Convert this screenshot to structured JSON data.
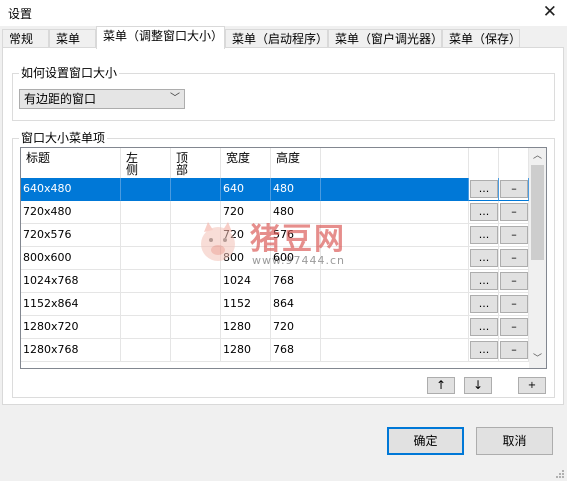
{
  "window": {
    "title": "设置",
    "close_glyph": "✕"
  },
  "tabs": [
    {
      "label": "常规",
      "active": false
    },
    {
      "label": "菜单",
      "active": false
    },
    {
      "label": "菜单（调整窗口大小）",
      "active": true
    },
    {
      "label": "菜单（启动程序）",
      "active": false
    },
    {
      "label": "菜单（窗户调光器）",
      "active": false
    },
    {
      "label": "菜单（保存）",
      "active": false
    }
  ],
  "sizing_group": {
    "label": "如何设置窗口大小",
    "combo_value": "有边距的窗口"
  },
  "items_group": {
    "label": "窗口大小菜单项"
  },
  "table": {
    "columns": [
      "标题",
      "左\n侧",
      "顶\n部",
      "宽度",
      "高度"
    ],
    "rows": [
      {
        "title": "640x480",
        "left": "",
        "top": "",
        "width": "640",
        "height": "480",
        "selected": true
      },
      {
        "title": "720x480",
        "left": "",
        "top": "",
        "width": "720",
        "height": "480",
        "selected": false
      },
      {
        "title": "720x576",
        "left": "",
        "top": "",
        "width": "720",
        "height": "576",
        "selected": false
      },
      {
        "title": "800x600",
        "left": "",
        "top": "",
        "width": "800",
        "height": "600",
        "selected": false
      },
      {
        "title": "1024x768",
        "left": "",
        "top": "",
        "width": "1024",
        "height": "768",
        "selected": false
      },
      {
        "title": "1152x864",
        "left": "",
        "top": "",
        "width": "1152",
        "height": "864",
        "selected": false
      },
      {
        "title": "1280x720",
        "left": "",
        "top": "",
        "width": "1280",
        "height": "720",
        "selected": false
      },
      {
        "title": "1280x768",
        "left": "",
        "top": "",
        "width": "1280",
        "height": "768",
        "selected": false
      }
    ],
    "edit_label": "...",
    "remove_label": "–"
  },
  "list_buttons": {
    "up": "↑",
    "down": "↓",
    "add": "+"
  },
  "dialog_buttons": {
    "ok": "确定",
    "cancel": "取消"
  },
  "watermark": {
    "text": "猪豆网",
    "url": "www.97444.cn"
  },
  "colors": {
    "selection": "#0078d7",
    "watermark": "#d9534f"
  }
}
